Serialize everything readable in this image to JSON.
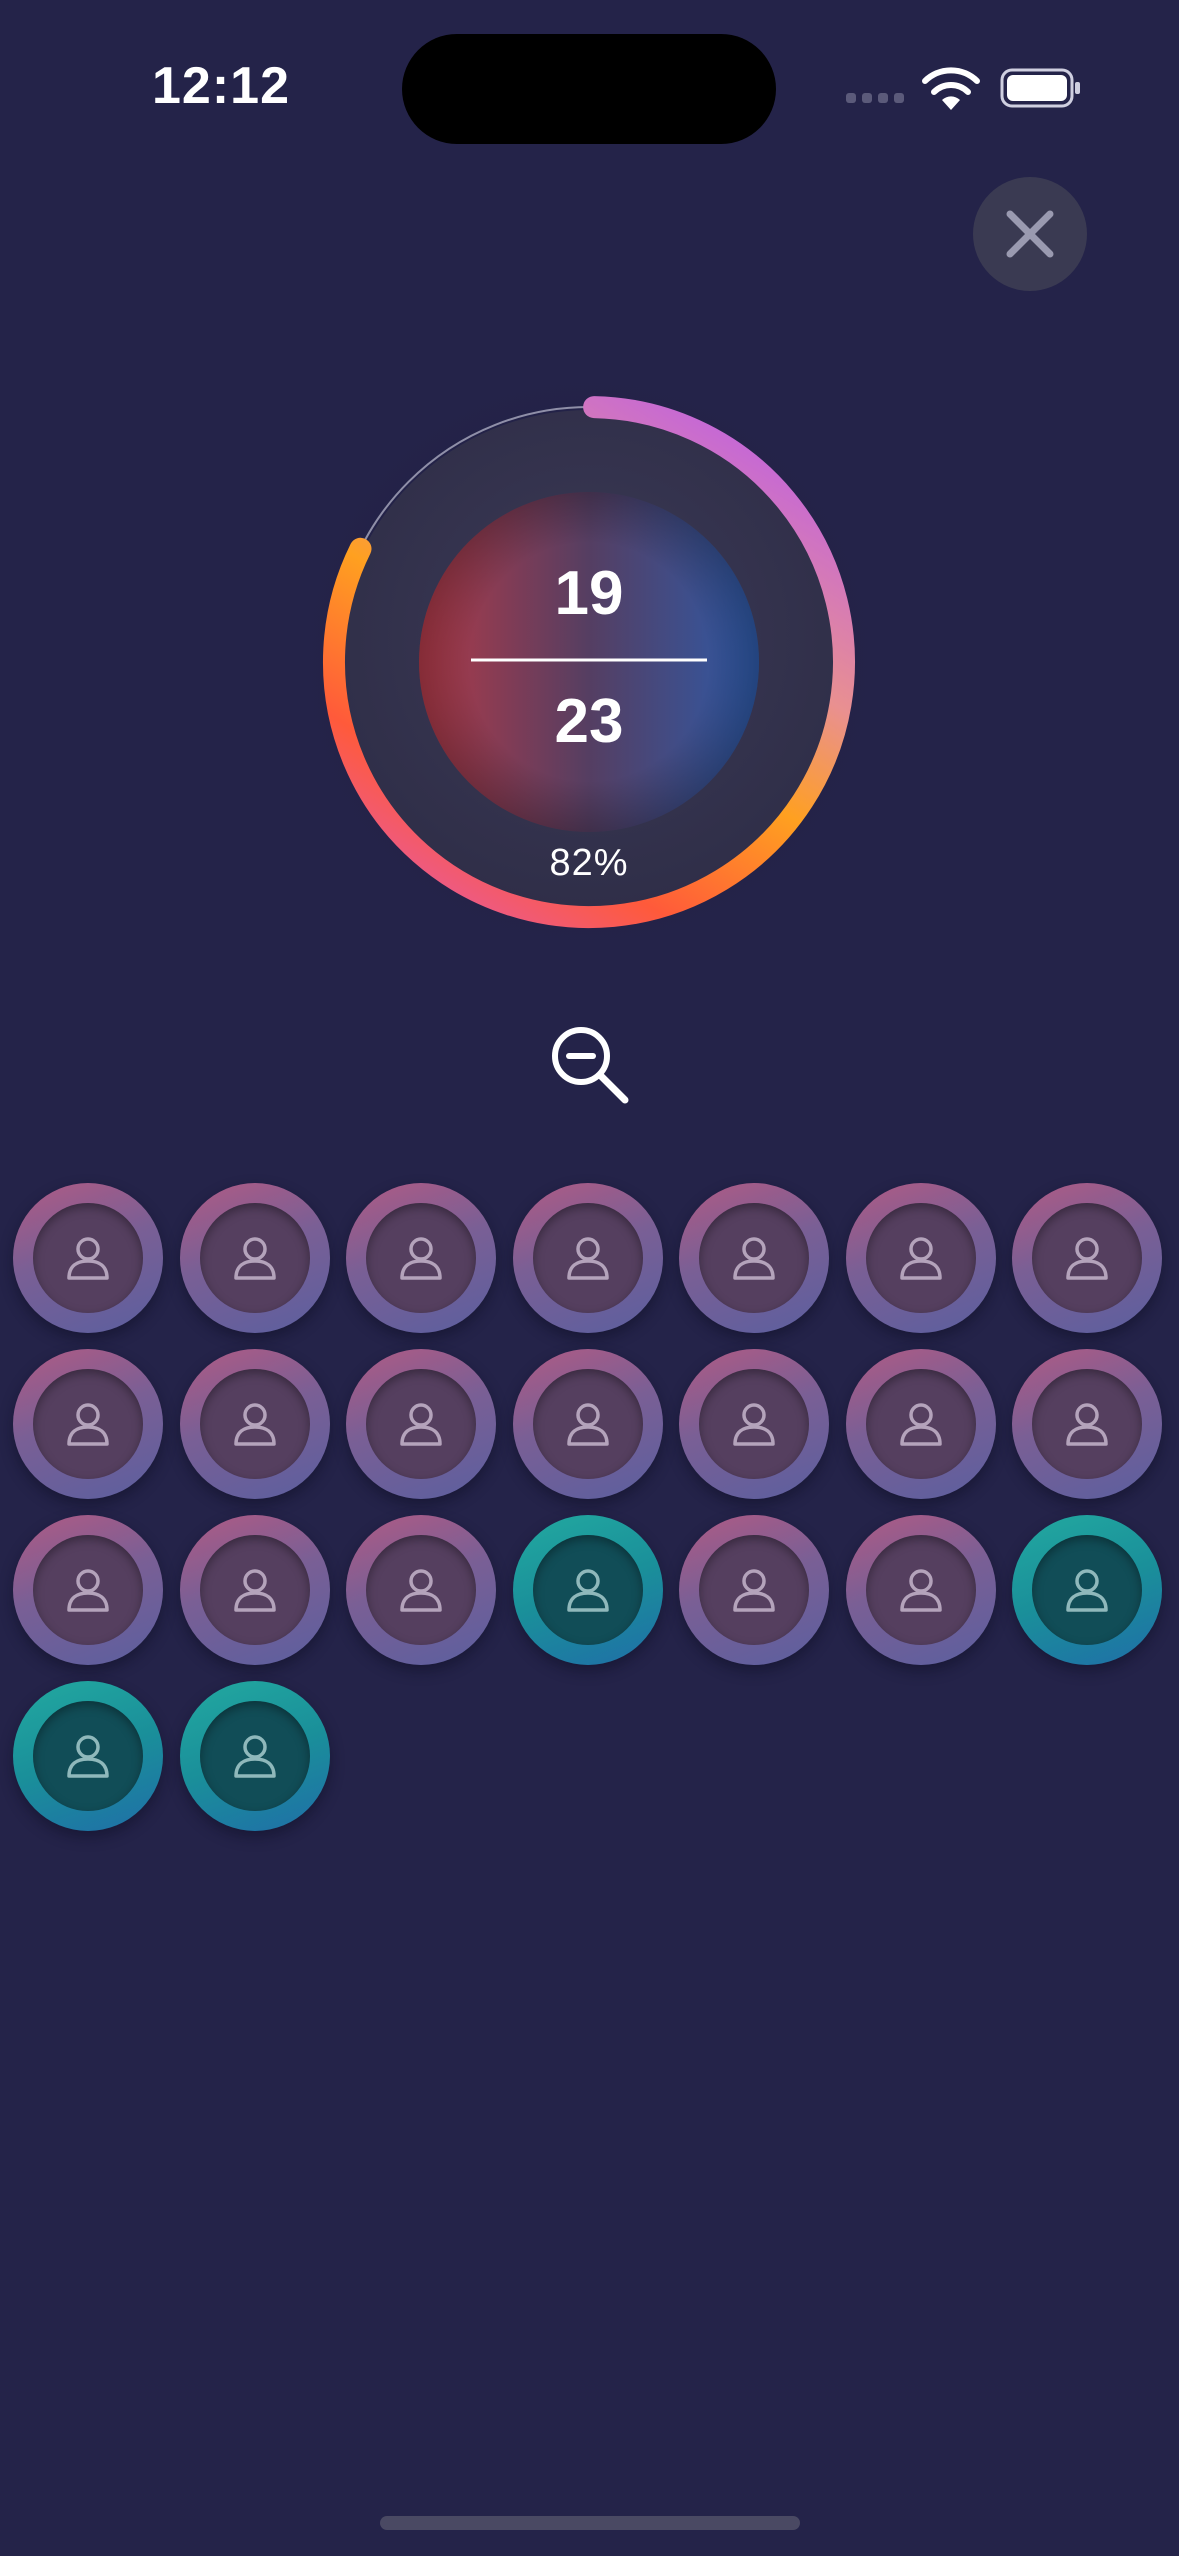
{
  "status_bar": {
    "time": "12:12"
  },
  "gauge": {
    "top_value": "19",
    "bottom_value": "23",
    "percent_label": "82%",
    "progress": 0.82
  },
  "icons": {
    "close": "close-icon",
    "zoom_out": "zoom-out-icon",
    "avatar": "person-icon"
  },
  "participants": [
    {
      "state": "inactive"
    },
    {
      "state": "inactive"
    },
    {
      "state": "inactive"
    },
    {
      "state": "inactive"
    },
    {
      "state": "inactive"
    },
    {
      "state": "inactive"
    },
    {
      "state": "inactive"
    },
    {
      "state": "inactive"
    },
    {
      "state": "inactive"
    },
    {
      "state": "inactive"
    },
    {
      "state": "inactive"
    },
    {
      "state": "inactive"
    },
    {
      "state": "inactive"
    },
    {
      "state": "inactive"
    },
    {
      "state": "inactive"
    },
    {
      "state": "inactive"
    },
    {
      "state": "inactive"
    },
    {
      "state": "active"
    },
    {
      "state": "inactive"
    },
    {
      "state": "inactive"
    },
    {
      "state": "active"
    },
    {
      "state": "active"
    },
    {
      "state": "active"
    }
  ],
  "colors": {
    "background": "#242349",
    "arc_start": "#c062e0",
    "arc_mid": "#ffa020",
    "arc_end": "#e85a98",
    "active_avatar": "#1a8f9a",
    "inactive_avatar": "#8a5f8f"
  }
}
